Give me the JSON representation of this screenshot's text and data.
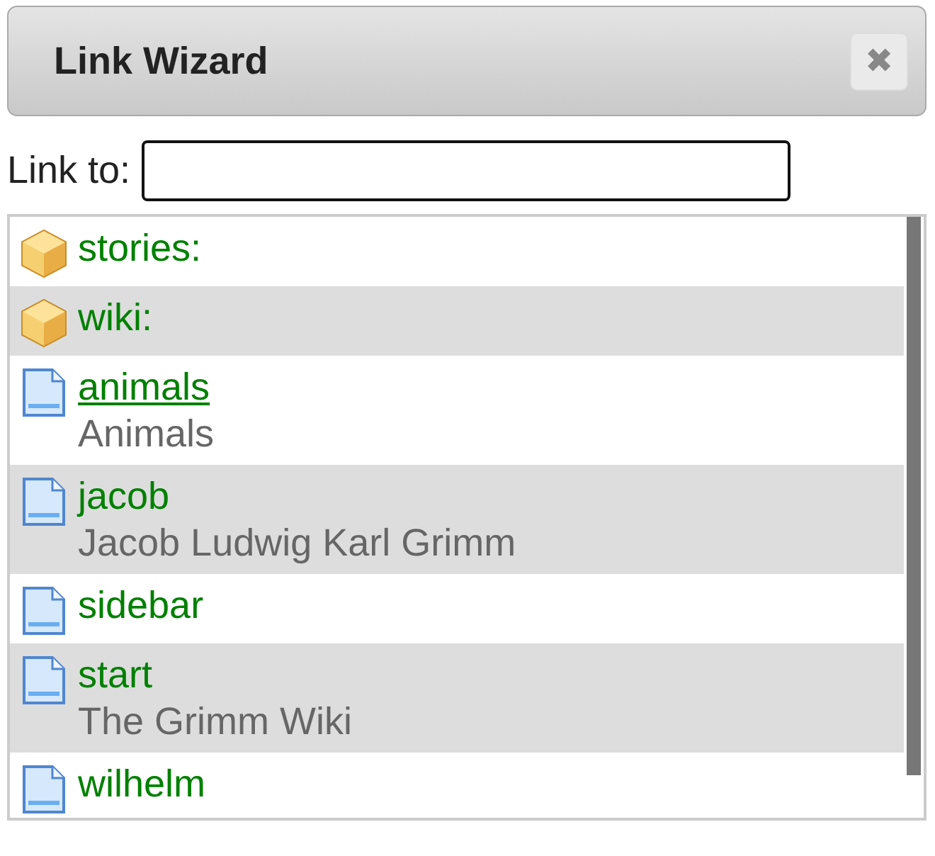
{
  "window": {
    "title": "Link Wizard",
    "close": "✖"
  },
  "link_field": {
    "label": "Link to:"
  },
  "items": [
    {
      "kind": "namespace",
      "name": "stories:",
      "hovered": false
    },
    {
      "kind": "namespace",
      "name": "wiki:",
      "hovered": false
    },
    {
      "kind": "page",
      "name": "animals",
      "title": "Animals",
      "hovered": true
    },
    {
      "kind": "page",
      "name": "jacob",
      "title": "Jacob Ludwig Karl Grimm",
      "hovered": false
    },
    {
      "kind": "page",
      "name": "sidebar",
      "hovered": false
    },
    {
      "kind": "page",
      "name": "start",
      "title": "The Grimm Wiki",
      "hovered": false
    },
    {
      "kind": "page",
      "name": "wilhelm",
      "hovered": false
    }
  ]
}
